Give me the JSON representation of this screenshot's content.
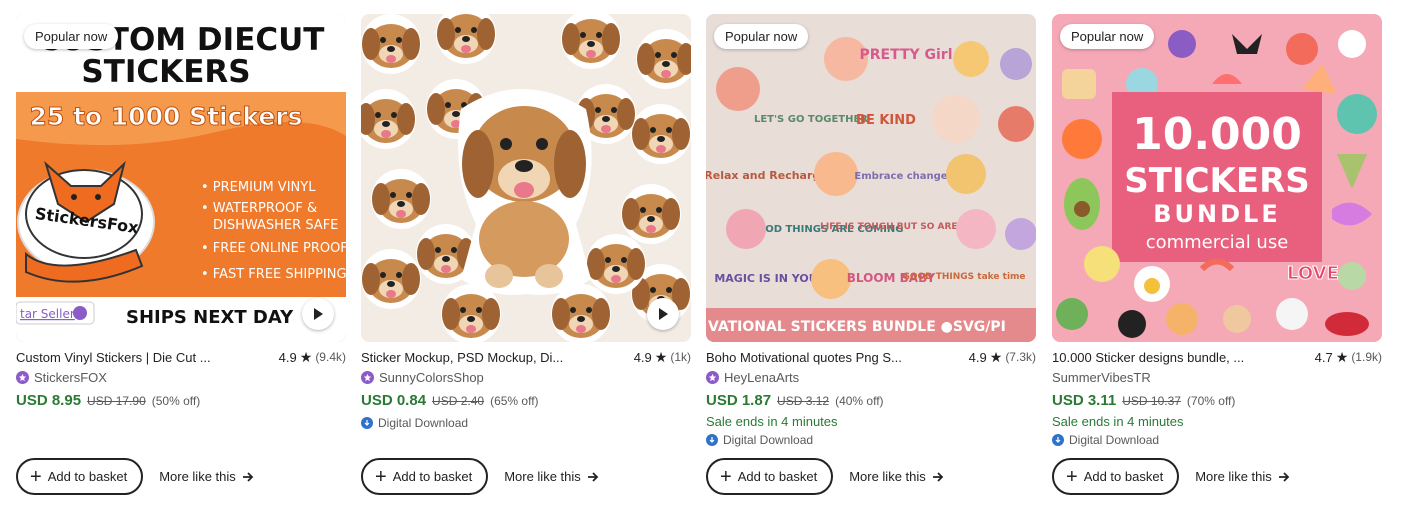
{
  "cards": [
    {
      "badge": "Popular now",
      "title": "Custom Vinyl Stickers | Die Cut ...",
      "rating": "4.9",
      "reviews": "(9.4k)",
      "shop": "StickersFOX",
      "star_seller": true,
      "price": "USD 8.95",
      "original_price": "USD 17.90",
      "discount": "(50% off)",
      "add_label": "Add to basket",
      "more_label": "More like this",
      "image_text": {
        "line1": "CUSTOM DIECUT",
        "line2": "STICKERS",
        "banner": "25 to 1000 Stickers",
        "features": [
          "• PREMIUM VINYL",
          "• WATERPROOF &",
          "DISHWASHER SAFE",
          "• FREE ONLINE PROOF",
          "• FAST FREE SHIPPING"
        ],
        "logo": "StickersFox",
        "star_seller_tag": "tar Seller",
        "ships": "SHIPS NEXT DAY"
      }
    },
    {
      "badge": "",
      "title": "Sticker Mockup, PSD Mockup, Di...",
      "rating": "4.9",
      "reviews": "(1k)",
      "shop": "SunnyColorsShop",
      "star_seller": true,
      "price": "USD 0.84",
      "original_price": "USD 2.40",
      "discount": "(65% off)",
      "download": "Digital Download",
      "add_label": "Add to basket",
      "more_label": "More like this"
    },
    {
      "badge": "Popular now",
      "title": "Boho Motivational quotes Png S...",
      "rating": "4.9",
      "reviews": "(7.3k)",
      "shop": "HeyLenaArts",
      "star_seller": true,
      "price": "USD 1.87",
      "original_price": "USD 3.12",
      "discount": "(40% off)",
      "sale": "Sale ends in 4 minutes",
      "download": "Digital Download",
      "add_label": "Add to basket",
      "more_label": "More like this",
      "image_text": {
        "banner": "VATIONAL STICKERS BUNDLE ●SVG/PI",
        "stickers": [
          "PRETTY Girl",
          "LET'S GO TOGETHER",
          "BE KIND",
          "Relax and Recharge",
          "GOOD THINGS ARE COMING",
          "LIFE IS TOUGH BUT SO ARE YOU",
          "MAGIC IS IN YOU",
          "BLOOM BABY",
          "GOOD THINGS take time",
          "Embrace change"
        ]
      }
    },
    {
      "badge": "Popular now",
      "title": "10.000 Sticker designs bundle, ...",
      "rating": "4.7",
      "reviews": "(1.9k)",
      "shop": "SummerVibesTR",
      "star_seller": false,
      "price": "USD 3.11",
      "original_price": "USD 10.37",
      "discount": "(70% off)",
      "sale": "Sale ends in 4 minutes",
      "download": "Digital Download",
      "add_label": "Add to basket",
      "more_label": "More like this",
      "image_text": {
        "big": "10.000",
        "stickers": "STICKERS",
        "bundle": "BUNDLE",
        "commercial": "commercial use",
        "love": "LOVE"
      }
    }
  ],
  "colors": {
    "price_green": "#2a7a35",
    "star_seller_purple": "#8b5cc7",
    "download_blue": "#2f73c9"
  }
}
